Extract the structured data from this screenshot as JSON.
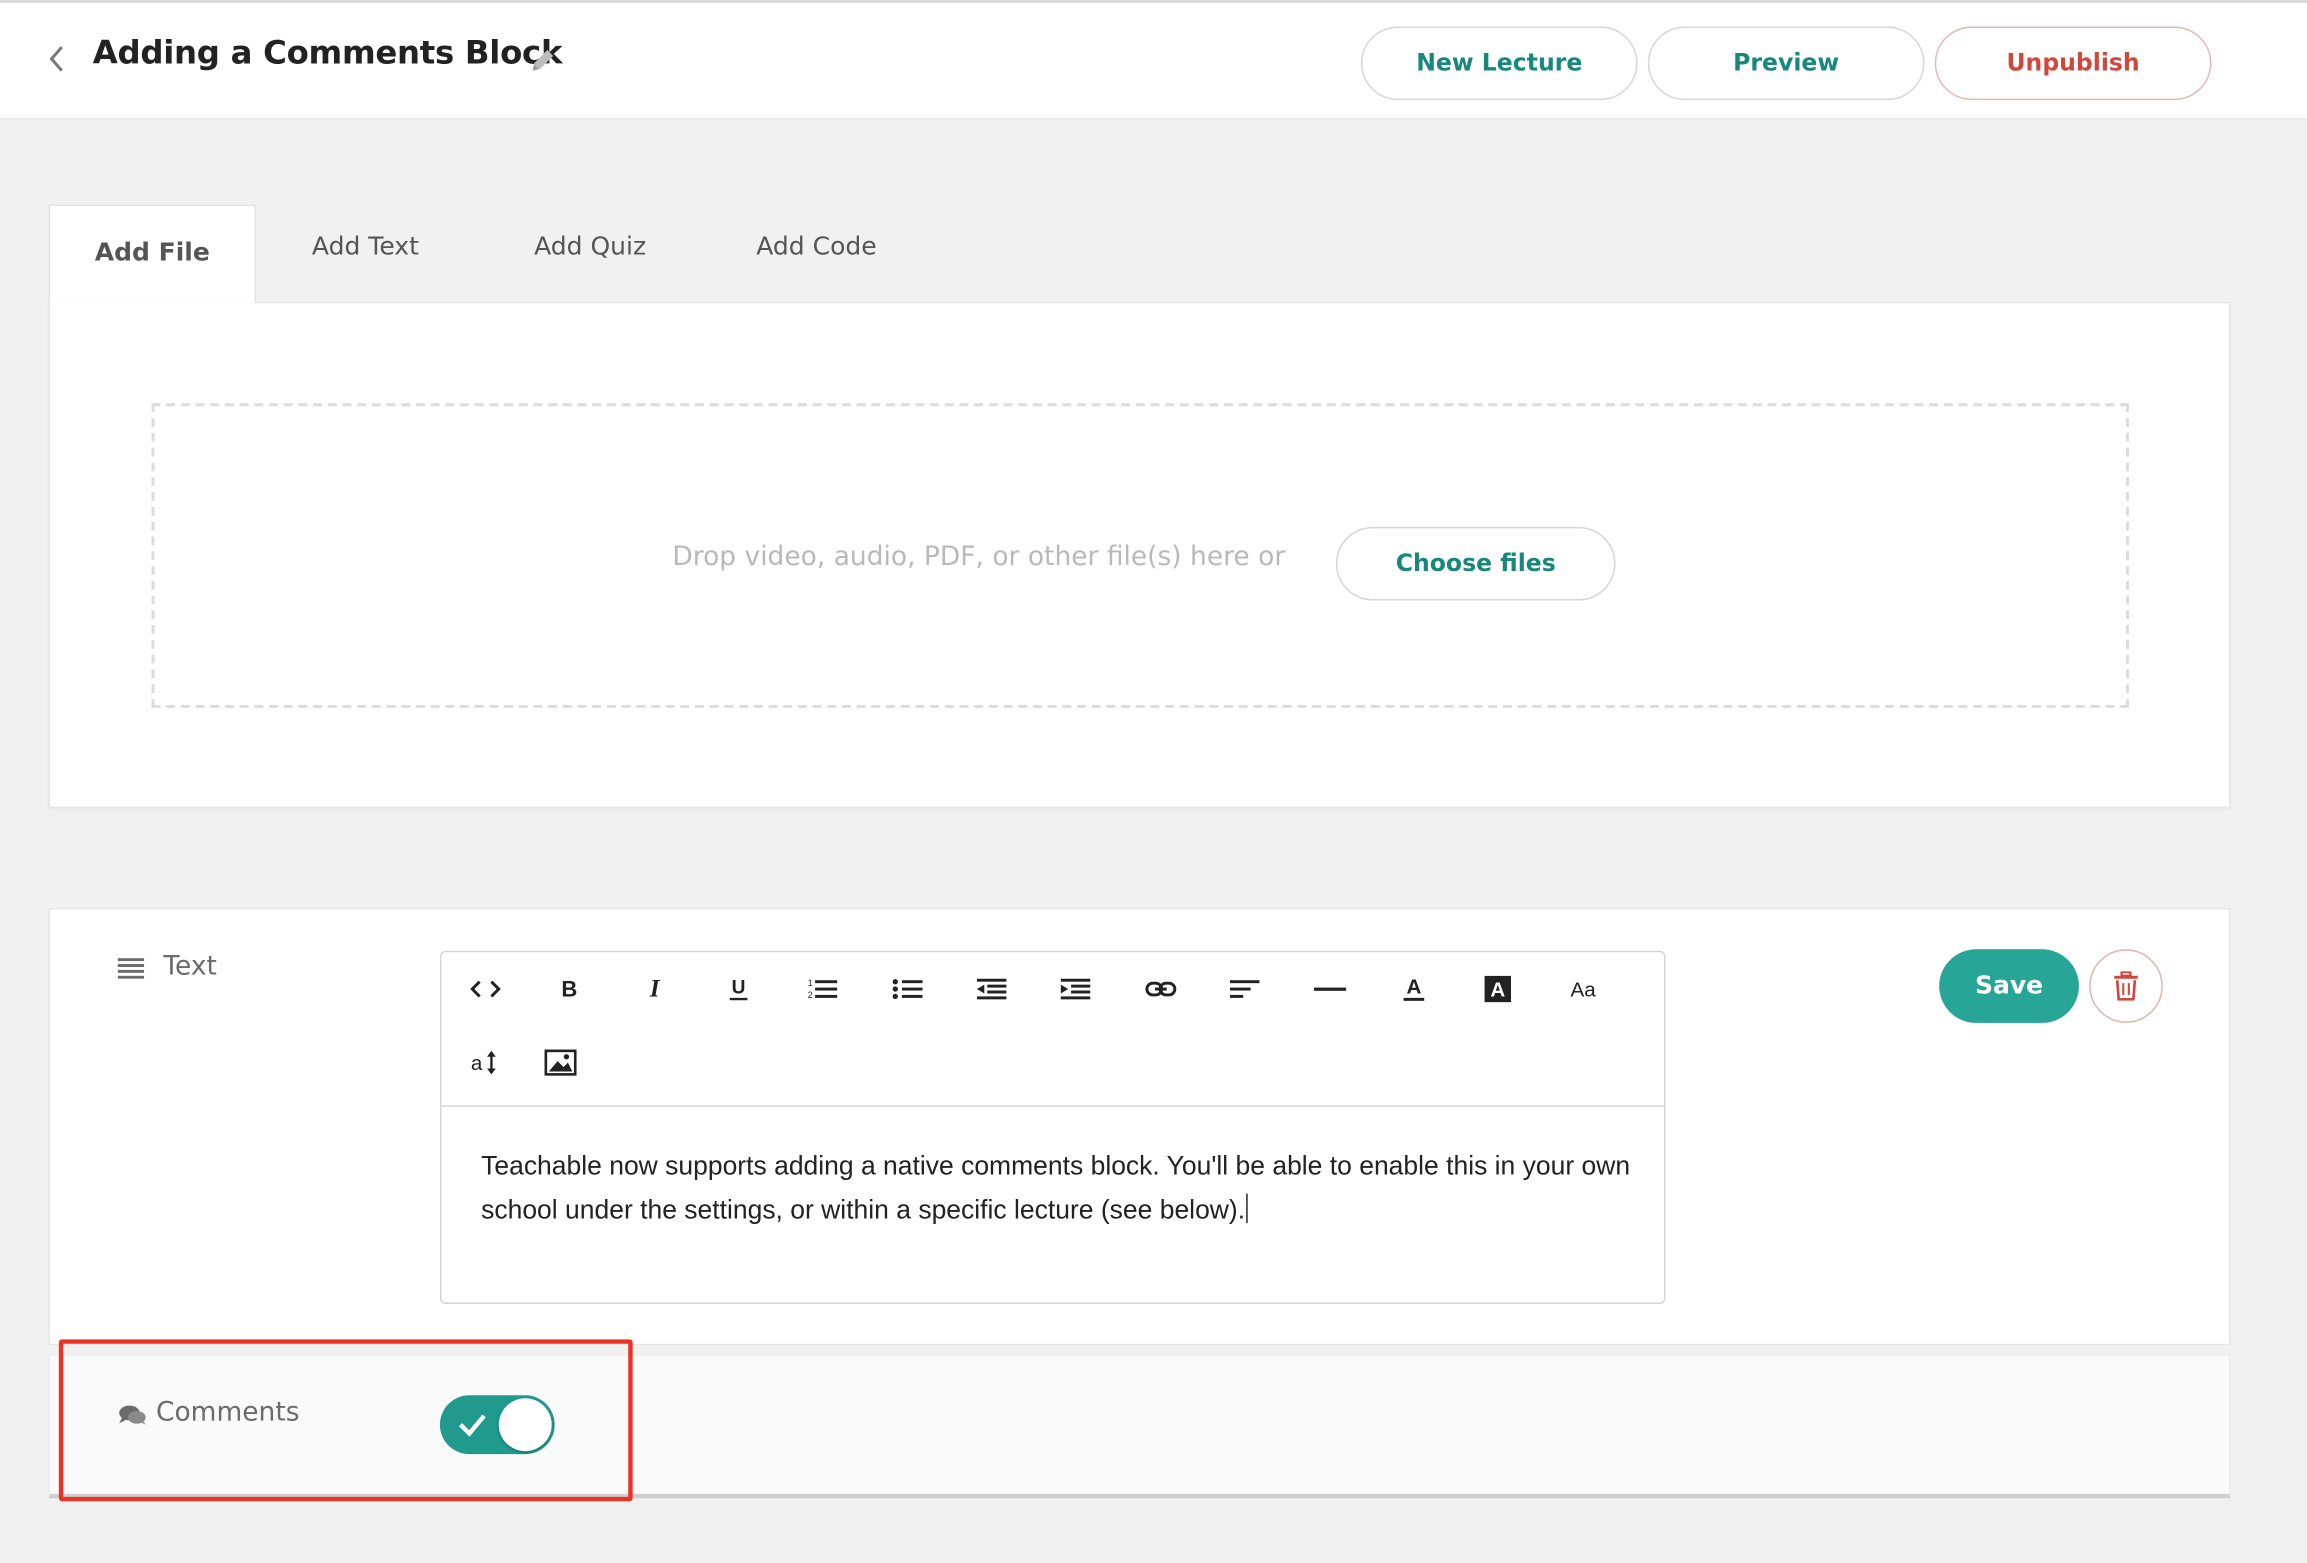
{
  "header": {
    "title": "Adding a Comments Block",
    "buttons": {
      "new_lecture": "New Lecture",
      "preview": "Preview",
      "unpublish": "Unpublish"
    }
  },
  "tabs": [
    {
      "label": "Add File",
      "active": true
    },
    {
      "label": "Add Text",
      "active": false
    },
    {
      "label": "Add Quiz",
      "active": false
    },
    {
      "label": "Add Code",
      "active": false
    }
  ],
  "upload": {
    "drop_text": "Drop video, audio, PDF, or other file(s) here or",
    "choose_files": "Choose files"
  },
  "text_block": {
    "label": "Text",
    "toolbar": [
      "code-view",
      "bold",
      "italic",
      "underline",
      "ordered-list",
      "unordered-list",
      "outdent",
      "indent",
      "link",
      "align",
      "horizontal-rule",
      "font-color",
      "background-color",
      "font-family",
      "font-size",
      "insert-image"
    ],
    "content": "Teachable now supports adding a native comments block. You'll be able to enable this in your own school under the settings, or within a specific lecture (see below).",
    "save": "Save"
  },
  "comments": {
    "label": "Comments",
    "enabled": true
  },
  "colors": {
    "accent": "#27a596",
    "danger": "#d0473c",
    "highlight": "#ea3323"
  }
}
